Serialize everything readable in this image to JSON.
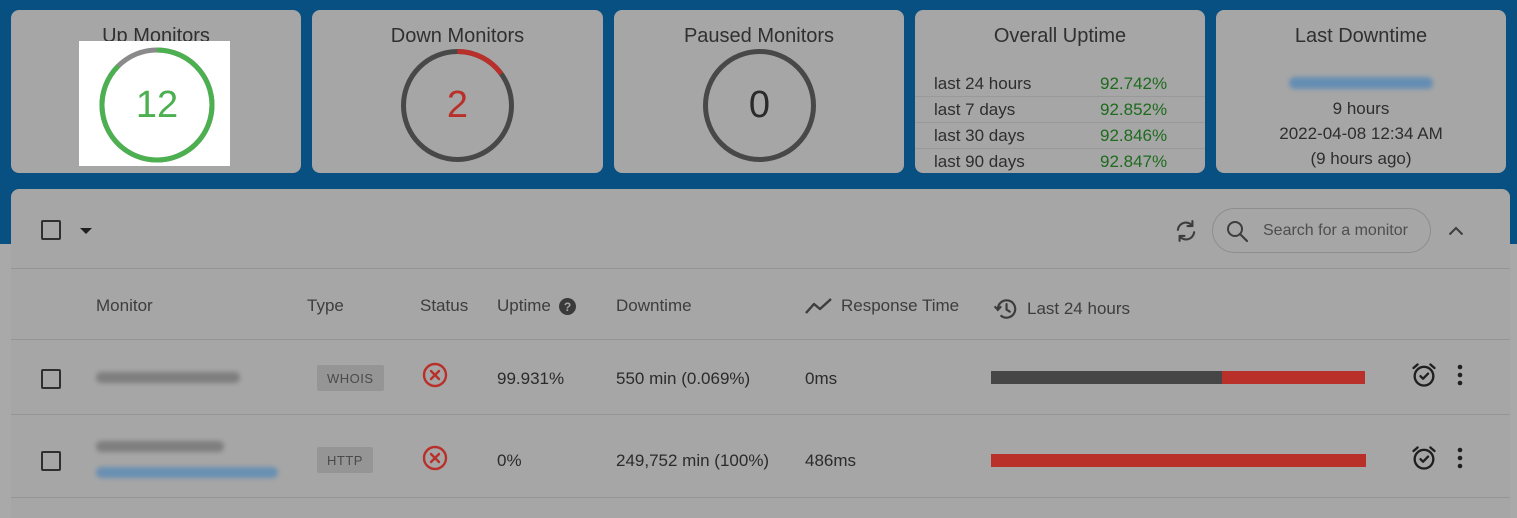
{
  "summary": {
    "up": {
      "title": "Up Monitors",
      "count": "12"
    },
    "down": {
      "title": "Down Monitors",
      "count": "2"
    },
    "paused": {
      "title": "Paused Monitors",
      "count": "0"
    },
    "overall_uptime": {
      "title": "Overall Uptime",
      "rows": [
        {
          "label": "last 24 hours",
          "value": "92.742%"
        },
        {
          "label": "last 7 days",
          "value": "92.852%"
        },
        {
          "label": "last 30 days",
          "value": "92.846%"
        },
        {
          "label": "last 90 days",
          "value": "92.847%"
        }
      ]
    },
    "last_downtime": {
      "title": "Last Downtime",
      "duration": "9 hours",
      "datetime": "2022-04-08 12:34 AM",
      "ago": "(9 hours ago)"
    }
  },
  "toolbar": {
    "search_placeholder": "Search for a monitor"
  },
  "table": {
    "headers": {
      "monitor": "Monitor",
      "type": "Type",
      "status": "Status",
      "uptime": "Uptime",
      "downtime": "Downtime",
      "response_time": "Response Time",
      "last24": "Last 24 hours"
    },
    "rows": [
      {
        "type": "WHOIS",
        "uptime": "99.931%",
        "downtime": "550 min (0.069%)",
        "response": "0ms",
        "last24_fractions": {
          "grey": 0.618,
          "red": 0.382
        }
      },
      {
        "type": "HTTP",
        "uptime": "0%",
        "downtime": "249,752 min (100%)",
        "response": "486ms",
        "last24_fractions": {
          "grey": 0,
          "red": 1
        }
      }
    ]
  },
  "colors": {
    "up": "#4caf50",
    "down": "#b9302a",
    "uptime_text": "#1e6b1e",
    "band": "#075081"
  }
}
